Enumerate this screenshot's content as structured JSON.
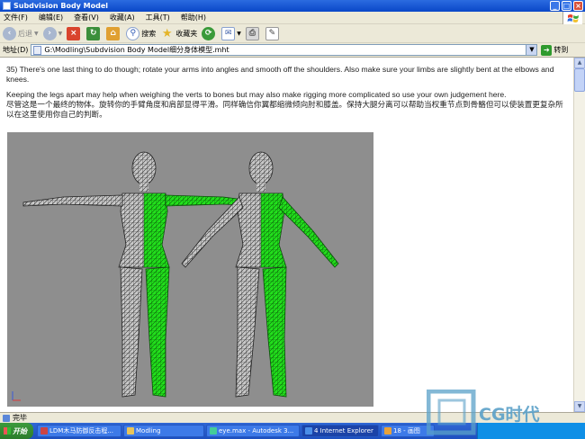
{
  "window": {
    "title": "Subdvision Body Model"
  },
  "menu": [
    "文件(F)",
    "编辑(E)",
    "查看(V)",
    "收藏(A)",
    "工具(T)",
    "帮助(H)"
  ],
  "toolbar": {
    "back": "后退",
    "search": "搜索",
    "favorites": "收藏夹"
  },
  "address": {
    "label": "地址(D)",
    "value": "G:\\Modling\\Subdvision Body Model细分身体模型.mht",
    "go": "转到"
  },
  "content": {
    "para1": "35) There's one last thing to do though; rotate your arms into angles and smooth off the shoulders. Also make sure your limbs are slightly bent at the elbows and knees.",
    "para2": "Keeping the legs apart may help when weighing the verts to bones but may also make rigging more complicated so use your own judgement here.",
    "para3": "尽管这是一个最终的物体。旋转你的手臂角度和肩部显得平滑。同样确信你翼都缩微倾向肘和膝盖。保持大腿分离可以帮助当权重节点到骨骼但可以使装置更复杂所以在这里使用你自己的判断。"
  },
  "status": {
    "text": "完毕"
  },
  "taskbar": {
    "start": "开始",
    "tasks": [
      {
        "label": "LDM木马防御反击程...",
        "color": "#c44"
      },
      {
        "label": "Modling",
        "color": "#e8c45a"
      },
      {
        "label": "eye.max - Autodesk 3...",
        "color": "#4c9"
      },
      {
        "label": "4 Internet Explorer",
        "color": "#4a8ee8"
      },
      {
        "label": "18 - 画图",
        "color": "#e8a23a"
      }
    ]
  },
  "watermark": {
    "text": "CG时代"
  },
  "colors": {
    "titlebar": "#0a47c8",
    "mesh_highlight": "#22e01c",
    "viewport_bg": "#8e8e8e"
  }
}
